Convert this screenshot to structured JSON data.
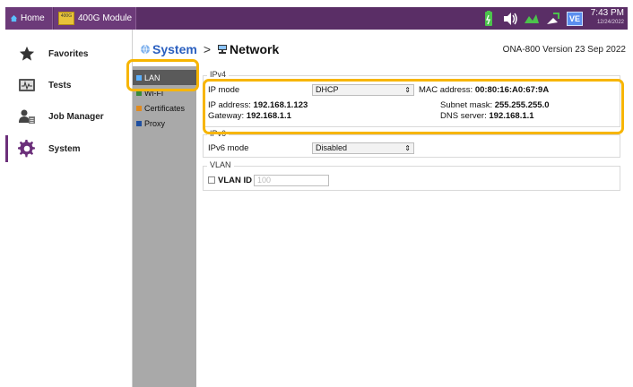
{
  "topbar": {
    "home_label": "Home",
    "module_label": "400G Module",
    "module_icon_text": "400G",
    "ve_label": "VE",
    "time": "7:43 PM",
    "date": "12/24/2022",
    "accent": "#5a2e66"
  },
  "nav": {
    "items": [
      {
        "label": "Favorites",
        "icon": "star-icon"
      },
      {
        "label": "Tests",
        "icon": "tests-icon"
      },
      {
        "label": "Job Manager",
        "icon": "job-manager-icon"
      },
      {
        "label": "System",
        "icon": "gear-icon",
        "active": true
      }
    ]
  },
  "header": {
    "system_label": "System",
    "separator": ">",
    "network_label": "Network",
    "version": "ONA-800 Version 23 Sep 2022"
  },
  "submenu": {
    "items": [
      {
        "label": "LAN",
        "active": true
      },
      {
        "label": "Wi-Fi"
      },
      {
        "label": "Certificates"
      },
      {
        "label": "Proxy"
      }
    ]
  },
  "ipv4": {
    "title": "IPv4",
    "ip_mode_label": "IP mode",
    "ip_mode_value": "DHCP",
    "mac_label": "MAC address:",
    "mac_value": "00:80:16:A0:67:9A",
    "ip_address_label": "IP address:",
    "ip_address_value": "192.168.1.123",
    "subnet_label": "Subnet mask:",
    "subnet_value": "255.255.255.0",
    "gateway_label": "Gateway:",
    "gateway_value": "192.168.1.1",
    "dns_label": "DNS server:",
    "dns_value": "192.168.1.1"
  },
  "ipv6": {
    "title": "IPv6",
    "mode_label": "IPv6 mode",
    "mode_value": "Disabled"
  },
  "vlan": {
    "title": "VLAN",
    "id_label": "VLAN ID",
    "id_placeholder": "100"
  },
  "colors": {
    "highlight": "#f7b500",
    "system_link": "#2a5fbf",
    "submenu_bg": "#a9a9a9",
    "submenu_active": "#5a5a5a"
  }
}
